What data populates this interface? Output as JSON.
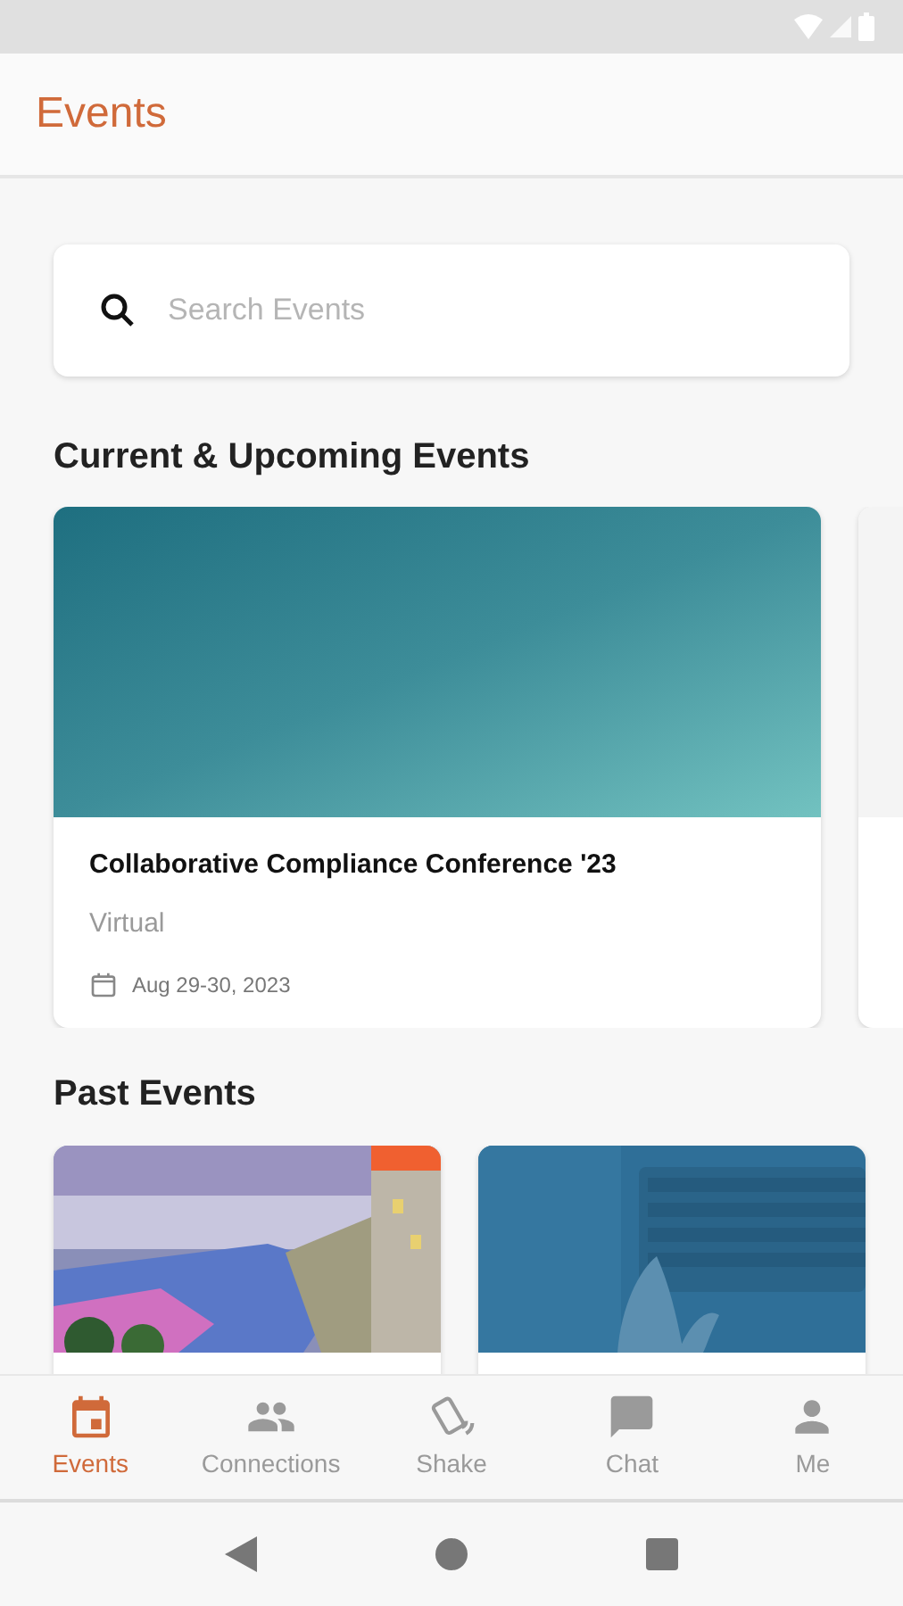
{
  "app_bar": {
    "title": "Events"
  },
  "search": {
    "placeholder": "Search Events"
  },
  "sections": [
    {
      "title": "Current & Upcoming Events",
      "kind": "upcoming",
      "cards": [
        {
          "kind": "event",
          "title": "Collaborative Compliance Conference '23",
          "location": "Virtual",
          "date": "Aug 29-30, 2023"
        },
        {
          "kind": "picture"
        }
      ]
    },
    {
      "title": "Past Events",
      "kind": "past",
      "cards": [
        {
          "kind": "picture"
        },
        {
          "kind": "picture"
        }
      ]
    }
  ],
  "bottom_nav": [
    {
      "label": "Events",
      "selected": true
    },
    {
      "label": "Connections",
      "selected": false
    },
    {
      "label": "Shake",
      "selected": false
    },
    {
      "label": "Chat",
      "selected": false
    },
    {
      "label": "Me",
      "selected": false
    }
  ]
}
